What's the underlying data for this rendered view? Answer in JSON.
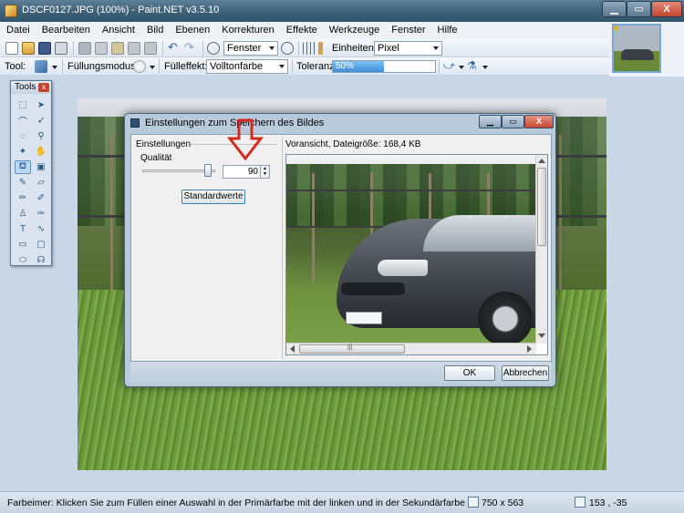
{
  "window": {
    "title": "DSCF0127.JPG (100%) - Paint.NET v3.5.10",
    "min_label": "▁",
    "max_label": "▭",
    "close_label": "X"
  },
  "menu": [
    "Datei",
    "Bearbeiten",
    "Ansicht",
    "Bild",
    "Ebenen",
    "Korrekturen",
    "Effekte",
    "Werkzeuge",
    "Fenster",
    "Hilfe"
  ],
  "toolbar1": {
    "zoom_combo": "Fenster",
    "units_label": "Einheiten:",
    "units_value": "Pixel"
  },
  "toolbar2": {
    "tool_label": "Tool:",
    "fill_mode_label": "Füllungsmodus:",
    "fill_effect_label": "Fülleffekt:",
    "fill_effect_value": "Volltonfarbe",
    "tolerance_label": "Toleranz:",
    "tolerance_value": "50%",
    "tolerance_fraction": 0.5
  },
  "tools_window": {
    "title": "Tools",
    "close_label": "x"
  },
  "dialog": {
    "title": "Einstellungen zum Speichern des Bildes",
    "settings_label": "Einstellungen",
    "quality_label": "Qualität",
    "quality_value": "90",
    "quality_fraction": 0.9,
    "defaults_button": "Standardwerte",
    "preview_label": "Voransicht, Dateigröße: 168,4 KB",
    "ok_button": "OK",
    "cancel_button": "Abbrechen",
    "min_label": "▁",
    "max_label": "▭",
    "close_label": "X",
    "scroll_grip": "|||"
  },
  "status": {
    "message": "Farbeimer: Klicken Sie zum Füllen einer Auswahl in der Primärfarbe mit der linken und in der Sekundärfarbe mit der rechten M",
    "image_size": "750 x 563",
    "cursor_pos": "153 , -35"
  },
  "colors": {
    "annotation_arrow": "#d62a1e",
    "titlebar": "#3e6077",
    "accent": "#3c8fd6"
  }
}
